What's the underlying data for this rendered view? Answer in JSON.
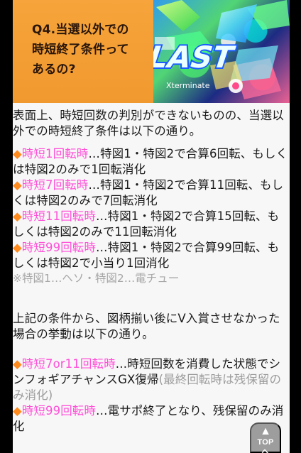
{
  "banner": {
    "title": "Q4.当選以外での\n時短終了条件って\nあるの?",
    "art_logo": "LAST",
    "art_tag": "Xterminate"
  },
  "article": {
    "intro": "表面上、時短回数の判別ができないものの、当選以外での時短終了条件は以下の通り。",
    "conditions": [
      {
        "bullet": "◆",
        "head": "時短1回転時",
        "body": "…特図1・特図2で合算6回転、もしくは特図2のみで1回転消化"
      },
      {
        "bullet": "◆",
        "head": "時短7回転時",
        "body": "…特図1・特図2で合算11回転、もしくは特図2のみで7回転消化"
      },
      {
        "bullet": "◆",
        "head": "時短11回転時",
        "body": "…特図1・特図2で合算15回転、もしくは特図2のみで11回転消化"
      },
      {
        "bullet": "◆",
        "head": "時短99回転時",
        "body": "…特図1・特図2で合算99回転、もしくは特図2で小当り1回消化"
      }
    ],
    "note": "※特図1…ヘソ・特図2…電チュー",
    "summary": "上記の条件から、図柄揃い後にV入賞させなかった場合の挙動は以下の通り。",
    "behaviors": [
      {
        "bullet": "◆",
        "head": "時短7or11回転時",
        "body": "…時短回数を消費した状態でシンフォギアチャンスGX復帰",
        "tail": "(最終回転時は残保留のみ消化)"
      },
      {
        "bullet": "◆",
        "head": "時短99回転時",
        "body": "…電サポ終了となり、残保留のみ消化",
        "tail": ""
      }
    ]
  },
  "top_button": {
    "label": "TOPへ",
    "arrow": "▲"
  },
  "colors": {
    "page_bg": "#000000",
    "card_bg": "#f7f7f7",
    "accent_orange": "#ff8b1f",
    "accent_pink": "#ff4fd8",
    "note_gray": "#a7a7a7",
    "banner_orange": "#f2a33a"
  },
  "icons": {
    "bullet": "diamond-icon",
    "top_arrow": "up-arrow-icon"
  }
}
